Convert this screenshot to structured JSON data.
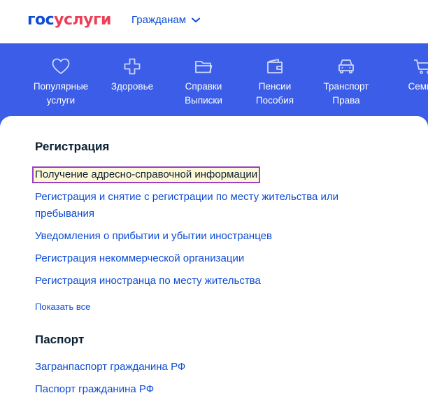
{
  "header": {
    "logo_part1": "гос",
    "logo_part2": "услуги",
    "audience_label": "Гражданам"
  },
  "categories": [
    {
      "icon": "heart-icon",
      "line1": "Популярные",
      "line2": "услуги"
    },
    {
      "icon": "health-cross-icon",
      "line1": "Здоровье",
      "line2": ""
    },
    {
      "icon": "folder-icon",
      "line1": "Справки",
      "line2": "Выписки"
    },
    {
      "icon": "wallet-icon",
      "line1": "Пенсии",
      "line2": "Пособия"
    },
    {
      "icon": "car-icon",
      "line1": "Транспорт",
      "line2": "Права"
    },
    {
      "icon": "cart-icon",
      "line1": "Семья",
      "line2": ""
    }
  ],
  "sections": [
    {
      "title": "Регистрация",
      "links": [
        "Получение адресно-справочной информации",
        "Регистрация и снятие с регистрации по месту жительства или",
        "пребывания",
        "Уведомления о прибытии и убытии иностранцев",
        "Регистрация некоммерческой организации",
        "Регистрация иностранца по месту жительства"
      ],
      "show_all": "Показать все"
    },
    {
      "title": "Паспорт",
      "links": [
        "Загранпаспорт гражданина РФ",
        "Паспорт гражданина РФ"
      ]
    }
  ],
  "colors": {
    "brand_blue": "#0d4cd3",
    "brand_red": "#ee3f58",
    "band_blue": "#3b5de7",
    "focus_outline": "#9a3fc9"
  }
}
